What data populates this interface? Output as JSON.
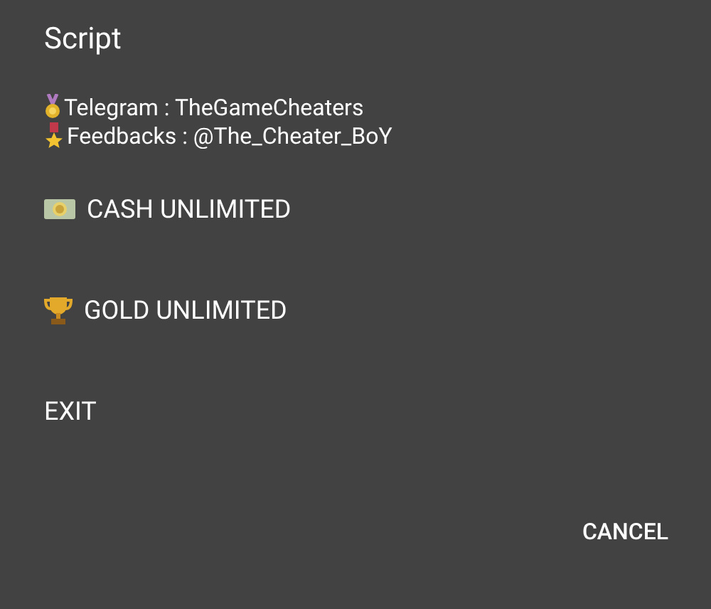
{
  "dialog": {
    "title": "Script",
    "info_lines": [
      {
        "kind": "medal",
        "text": "Telegram : TheGameCheaters"
      },
      {
        "kind": "star-medal",
        "text": "Feedbacks : @The_Cheater_BoY"
      }
    ],
    "items": [
      {
        "kind": "cash",
        "label": "CASH UNLIMITED"
      },
      {
        "kind": "trophy",
        "label": "GOLD UNLIMITED"
      },
      {
        "kind": "plain",
        "label": "EXIT"
      }
    ],
    "buttons": [
      "CANCEL"
    ]
  }
}
